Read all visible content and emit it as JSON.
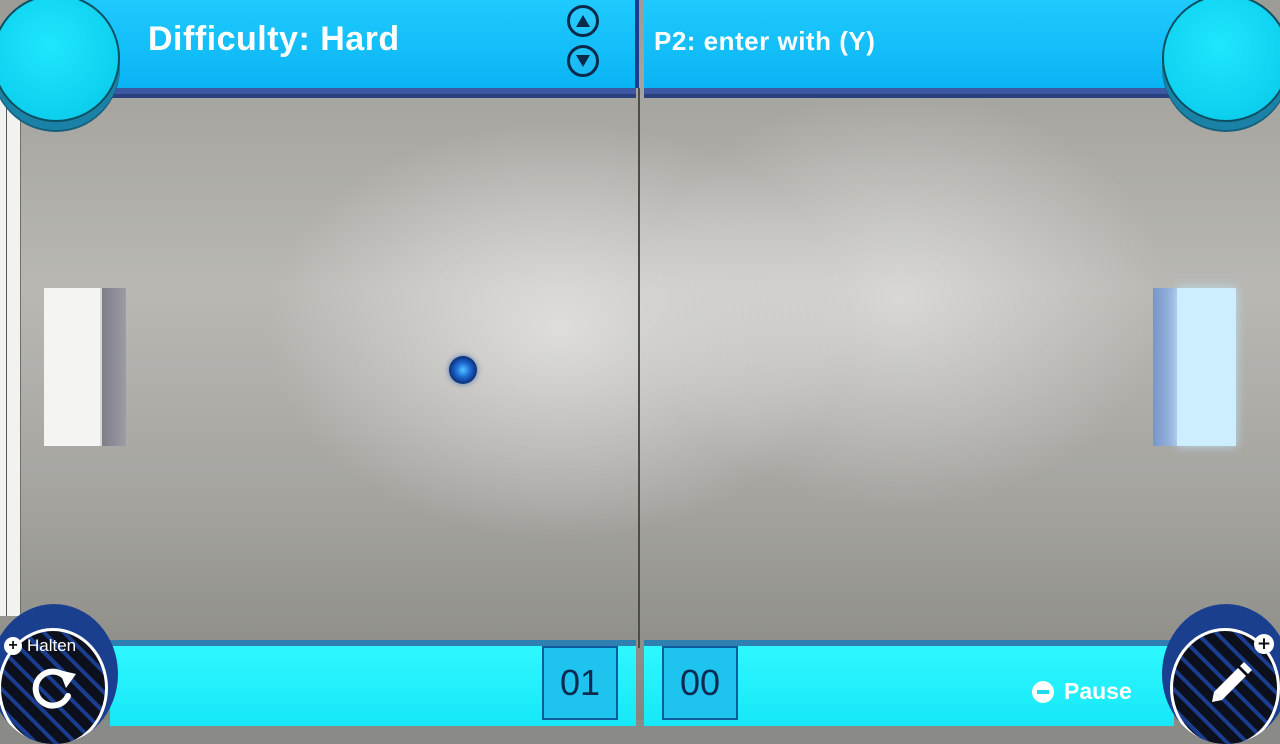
{
  "header": {
    "difficulty_label": "Difficulty: Hard",
    "p2_prompt": "P2: enter with (Y)",
    "difficulty_up_icon": "arrow-up-icon",
    "difficulty_down_icon": "arrow-down-icon"
  },
  "scores": {
    "p1": "01",
    "p2": "00"
  },
  "controls": {
    "hold_label": "Halten",
    "hold_icon": "plus-icon",
    "restart_icon": "rotate-icon",
    "pause_label": "Pause",
    "pause_icon": "minus-icon",
    "edit_icon": "pencil-icon",
    "edit_plus_icon": "plus-icon"
  },
  "colors": {
    "bar_top": "#0ab4f4",
    "bar_bottom": "#16e8f7",
    "corner": "#1fe7ff",
    "border_blue": "#3d57a3"
  }
}
